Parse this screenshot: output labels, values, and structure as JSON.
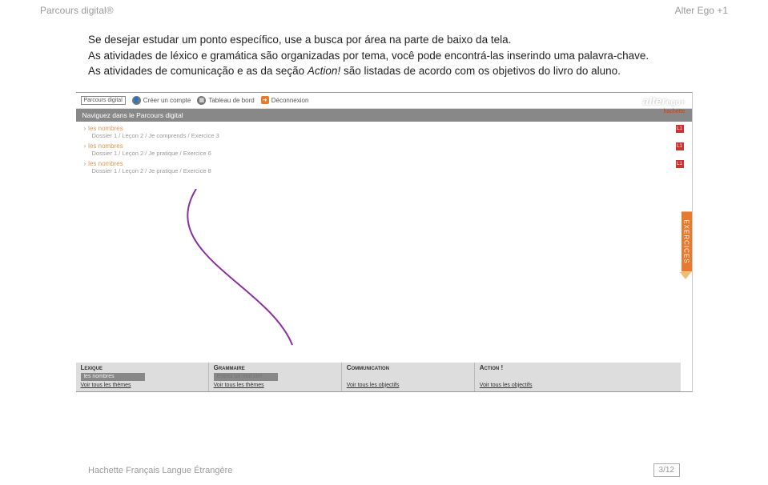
{
  "header": {
    "left": "Parcours digital®",
    "right": "Alter Ego +1"
  },
  "paragraph": {
    "l1": "Se desejar estudar um ponto específico, use a busca por área na parte de baixo da tela.",
    "l2": "As atividades de léxico e gramática são organizadas por tema, você pode encontrá-las inserindo uma palavra-chave.",
    "l3a": "As atividades de comunicação e as da seção ",
    "l3i": "Action!",
    "l3b": " são listadas de acordo com os objetivos do livro do aluno."
  },
  "app": {
    "logo": "Parcours digital",
    "topbar": {
      "creer": "Créer un compte",
      "tableau": "Tableau de bord",
      "deconn": "Déconnexion"
    },
    "brand": "alter",
    "brand2": "ego+",
    "publisher": "hachette",
    "navstrip": "Naviguez dans le Parcours digital",
    "results": [
      {
        "title": "les nombres",
        "path": "Dossier 1  /  Leçon 2  /  Je comprends  /  Exercice 3",
        "badge": "L1"
      },
      {
        "title": "les nombres",
        "path": "Dossier 1  /  Leçon 2  /  Je pratique  /  Exercice 6",
        "badge": "L1"
      },
      {
        "title": "les nombres",
        "path": "Dossier 1  /  Leçon 2  /  Je pratique  /  Exercice 8",
        "badge": "L1"
      }
    ],
    "side_tab": "EXERCICES",
    "bottom": {
      "cols": [
        {
          "head": "Lexique",
          "input": "les nombres",
          "link": "Voir tous les thèmes"
        },
        {
          "head": "Grammaire",
          "input": "Entrez un mot clef",
          "link": "Voir tous les thèmes"
        },
        {
          "head": "Communication",
          "input": "",
          "link": "Voir tous les objectifs"
        },
        {
          "head": "Action !",
          "input": "",
          "link": "Voir tous les objectifs"
        }
      ]
    }
  },
  "footer": {
    "left": "Hachette Français Langue Étrangère",
    "page": "3/12"
  }
}
